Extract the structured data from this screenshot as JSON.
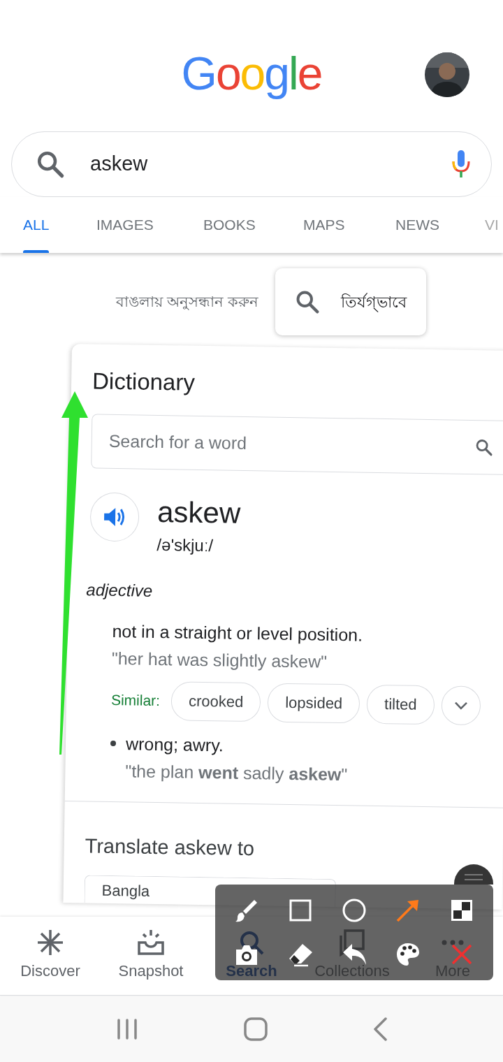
{
  "header": {
    "logo": "Google"
  },
  "search": {
    "value": "askew"
  },
  "tabs": [
    {
      "label": "ALL",
      "selected": true
    },
    {
      "label": "IMAGES",
      "selected": false
    },
    {
      "label": "BOOKS",
      "selected": false
    },
    {
      "label": "MAPS",
      "selected": false
    },
    {
      "label": "NEWS",
      "selected": false
    },
    {
      "label": "VI",
      "selected": false
    }
  ],
  "language_hint": {
    "label": "বাঙলায় অনুসন্ধান করুন",
    "query": "তির্যগ্ভাবে"
  },
  "dictionary": {
    "title": "Dictionary",
    "search_placeholder": "Search for a word",
    "word": "askew",
    "phonetic": "/ə'skjuː/",
    "part_of_speech": "adjective",
    "senses": [
      {
        "bulleted": false,
        "definition": "not in a straight or level position.",
        "example": "\"her hat was slightly askew\"",
        "similar_label": "Similar:",
        "similar": [
          "crooked",
          "lopsided",
          "tilted"
        ]
      },
      {
        "bulleted": true,
        "definition": "wrong; awry.",
        "example": "\"the plan **went** sadly **askew**\""
      }
    ]
  },
  "translate": {
    "title": "Translate askew to",
    "language": "Bangla"
  },
  "bottom_nav": [
    {
      "kind": "discover",
      "label": "Discover",
      "selected": false
    },
    {
      "kind": "snapshot",
      "label": "Snapshot",
      "selected": false
    },
    {
      "kind": "search",
      "label": "Search",
      "selected": true
    },
    {
      "kind": "collections",
      "label": "Collections",
      "selected": false
    },
    {
      "kind": "more",
      "label": "More",
      "selected": false
    }
  ],
  "drawing_toolbar": {
    "tools": [
      {
        "kind": "brush",
        "selected": false
      },
      {
        "kind": "rectangle",
        "selected": false
      },
      {
        "kind": "circle",
        "selected": false
      },
      {
        "kind": "arrow",
        "selected": true
      },
      {
        "kind": "mosaic",
        "selected": false
      },
      {
        "kind": "camera",
        "selected": false
      },
      {
        "kind": "eraser",
        "selected": false
      },
      {
        "kind": "undo",
        "selected": false
      },
      {
        "kind": "palette",
        "selected": false
      },
      {
        "kind": "close",
        "selected": false
      }
    ]
  }
}
